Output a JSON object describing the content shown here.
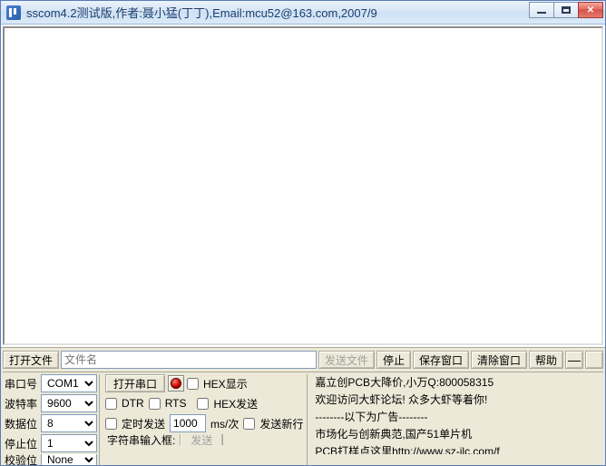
{
  "titlebar": {
    "text": "sscom4.2测试版,作者:聂小猛(丁丁),Email:mcu52@163.com,2007/9"
  },
  "filebar": {
    "open_file_label": "打开文件",
    "filename_placeholder": "文件名",
    "filename_value": "",
    "send_file_label": "发送文件",
    "stop_label": "停止",
    "save_window_label": "保存窗口",
    "clear_window_label": "清除窗口",
    "help_label": "帮助"
  },
  "params": {
    "port_label": "串口号",
    "port_value": "COM1",
    "baud_label": "波特率",
    "baud_value": "9600",
    "data_label": "数据位",
    "data_value": "8",
    "stop_label": "停止位",
    "stop_value": "1",
    "parity_label": "校验位",
    "parity_value": "None"
  },
  "mid": {
    "open_port_label": "打开串口",
    "dtr_label": "DTR",
    "rts_label": "RTS",
    "timed_send_label": "定时发送",
    "interval_value": "1000",
    "interval_unit": "ms/次",
    "string_input_label": "字符串输入框:",
    "send_label": "发送",
    "hex_display_label": "HEX显示",
    "hex_send_label": "HEX发送",
    "send_newline_label": "发送新行"
  },
  "ads": {
    "line1": "嘉立创PCB大降价,小万Q:800058315",
    "line2": "欢迎访问大虾论坛! 众多大虾等着你!",
    "line3": "--------以下为广告--------",
    "line4": "市场化与创新典范,国产51单片机",
    "line5": "PCB打样点这里http://www.sz-jlc.com/f"
  }
}
